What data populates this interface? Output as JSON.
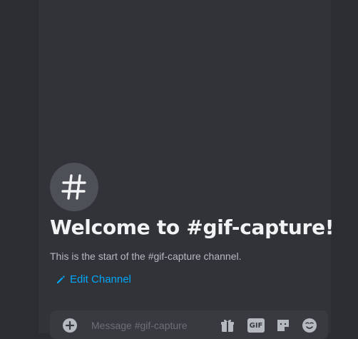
{
  "channel": {
    "welcome_title": "Welcome to #gif-capture!",
    "start_text": "This is the start of the #gif-capture channel.",
    "edit_label": "Edit Channel"
  },
  "composer": {
    "placeholder": "Message #gif-capture",
    "gif_label": "GIF"
  },
  "colors": {
    "accent_link": "#00a8fc",
    "background": "#313338",
    "sidebar": "#2b2d31",
    "composer": "#383a40"
  },
  "icons": [
    "hash-icon",
    "pencil-icon",
    "add-circle-icon",
    "gift-icon",
    "gif-icon",
    "sticker-icon",
    "emoji-icon"
  ]
}
